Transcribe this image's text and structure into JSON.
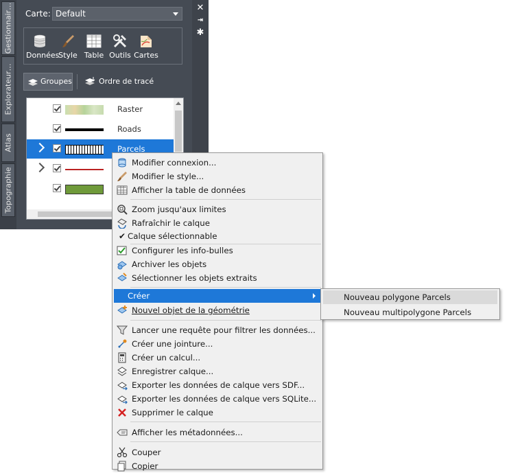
{
  "panel": {
    "vertical_tabs": [
      "Gestionnair…",
      "Explorateur…",
      "Atlas",
      "Topographie"
    ],
    "carte_label": "Carte:",
    "carte_value": "Default",
    "tools": [
      {
        "label": "Données",
        "icon": "database-icon"
      },
      {
        "label": "Style",
        "icon": "brush-icon"
      },
      {
        "label": "Table",
        "icon": "table-icon"
      },
      {
        "label": "Outils",
        "icon": "tools-icon"
      },
      {
        "label": "Cartes",
        "icon": "map-icon"
      }
    ],
    "groups_label": "Groupes",
    "draw_order_label": "Ordre de tracé",
    "right_icons": [
      "close-icon",
      "pin-icon",
      "settings-icon"
    ]
  },
  "layers": [
    {
      "name": "Raster",
      "checked": true,
      "selected": false
    },
    {
      "name": "Roads",
      "checked": true,
      "selected": false
    },
    {
      "name": "Parcels",
      "checked": true,
      "selected": true
    },
    {
      "name": "",
      "checked": true,
      "selected": false
    },
    {
      "name": "",
      "checked": true,
      "selected": false
    }
  ],
  "context_menu": {
    "items": [
      {
        "label": "Modifier connexion...",
        "icon": "connection-icon"
      },
      {
        "label": "Modifier le style...",
        "icon": "brush-icon"
      },
      {
        "label": "Afficher la table de données",
        "icon": "table-icon"
      },
      {
        "label": "Zoom jusqu'aux limites",
        "icon": "zoom-extents-icon"
      },
      {
        "label": "Rafraîchir le calque",
        "icon": "refresh-icon"
      },
      {
        "label": "Calque sélectionnable",
        "icon": "checkmark-icon"
      },
      {
        "label": "Configurer les info-bulles",
        "icon": "tooltip-config-icon"
      },
      {
        "label": "Archiver les objets",
        "icon": "checkin-icon"
      },
      {
        "label": "Sélectionner les objets extraits",
        "icon": "select-checked-out-icon"
      },
      {
        "label": "Créer",
        "icon": ""
      },
      {
        "label": "Nouvel objet de la géométrie",
        "icon": "new-feature-icon"
      },
      {
        "label": "Lancer une requête pour filtrer les données...",
        "icon": "filter-icon"
      },
      {
        "label": "Créer une jointure...",
        "icon": "join-icon"
      },
      {
        "label": "Créer un calcul...",
        "icon": "calculator-icon"
      },
      {
        "label": "Enregistrer calque...",
        "icon": "save-layer-icon"
      },
      {
        "label": "Exporter les données de calque vers SDF...",
        "icon": "export-sdf-icon"
      },
      {
        "label": "Exporter les données de calque vers SQLite...",
        "icon": "export-sqlite-icon"
      },
      {
        "label": "Supprimer le calque",
        "icon": "delete-icon"
      },
      {
        "label": "Afficher les métadonnées...",
        "icon": "metadata-icon"
      },
      {
        "label": "Couper",
        "icon": "cut-icon"
      },
      {
        "label": "Copier",
        "icon": "copy-icon"
      }
    ]
  },
  "submenu": {
    "items": [
      "Nouveau polygone Parcels",
      "Nouveau multipolygone Parcels"
    ]
  },
  "colors": {
    "panel_bg": "#454b54",
    "selection": "#1e78d8",
    "menu_bg": "#f0f0f0"
  }
}
